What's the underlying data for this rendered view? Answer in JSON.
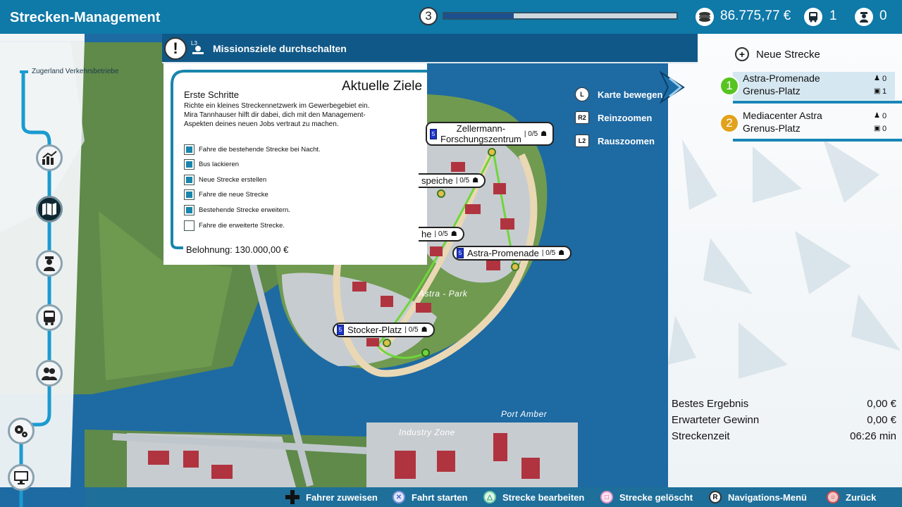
{
  "header": {
    "title": "Strecken-Management",
    "level": "3",
    "level_progress": 0.3,
    "money": "86.775,77 €",
    "buses": "1",
    "drivers": "0"
  },
  "sidebar": {
    "company": "Zugerland Verkehrsbetriebe",
    "items": [
      {
        "name": "statistics",
        "icon": "chart-icon"
      },
      {
        "name": "map",
        "icon": "map-icon",
        "active": true
      },
      {
        "name": "drivers",
        "icon": "driver-icon"
      },
      {
        "name": "buses",
        "icon": "bus-icon"
      },
      {
        "name": "people",
        "icon": "people-icon"
      },
      {
        "name": "settings",
        "icon": "gear-icon"
      },
      {
        "name": "computer",
        "icon": "monitor-icon"
      }
    ]
  },
  "mission": {
    "toggle_label": "Missionsziele durchschalten",
    "button_hint": "L3",
    "heading": "Aktuelle Ziele",
    "goal_title": "Erste Schritte",
    "goal_desc": "Richte ein kleines Streckennetzwerk im Gewerbegebiet ein. Mira Tannhauser hilft dir dabei, dich mit den Management-Aspekten deines neuen Jobs vertraut zu machen.",
    "tasks": [
      {
        "label": "Fahre die bestehende Strecke bei Nacht.",
        "done": true
      },
      {
        "label": "Bus lackieren",
        "done": true
      },
      {
        "label": "Neue Strecke erstellen",
        "done": true
      },
      {
        "label": "Fahre die neue Strecke",
        "done": true
      },
      {
        "label": "Bestehende Strecke erweitern.",
        "done": true
      },
      {
        "label": "Fahre die erweiterte Strecke.",
        "done": false
      }
    ],
    "reward": "Belohnung: 130.000,00 €"
  },
  "map": {
    "stops": [
      {
        "name": "Zellermann-\nForschungszentrum",
        "cap": "| 0/5"
      },
      {
        "name": "speiche",
        "cap": "| 0/5"
      },
      {
        "name": "he",
        "cap": "| 0/5"
      },
      {
        "name": "Astra-Promenade",
        "cap": "| 0/5"
      },
      {
        "name": "Stocker-Platz",
        "cap": "| 0/5"
      }
    ],
    "labels": {
      "park": "Astra - Park",
      "port": "Port Amber",
      "industry": "Industry Zone"
    },
    "controls": [
      {
        "key": "L",
        "label": "Karte bewegen"
      },
      {
        "key": "R2",
        "label": "Reinzoomen"
      },
      {
        "key": "L2",
        "label": "Rauszoomen"
      }
    ]
  },
  "routes": {
    "new_label": "Neue Strecke",
    "list": [
      {
        "num": "1",
        "line1": "Astra-Promenade",
        "line2": "Grenus-Platz",
        "drivers": "0",
        "buses": "1",
        "color": "#58c422"
      },
      {
        "num": "2",
        "line1": "Mediacenter Astra",
        "line2": "Grenus-Platz",
        "drivers": "0",
        "buses": "0",
        "color": "#e2a21c"
      }
    ]
  },
  "results": {
    "best_label": "Bestes Ergebnis",
    "best_value": "0,00 €",
    "expected_label": "Erwarteter Gewinn",
    "expected_value": "0,00 €",
    "time_label": "Streckenzeit",
    "time_value": "06:26 min"
  },
  "bottom": {
    "assign": "Fahrer zuweisen",
    "start": "Fahrt starten",
    "edit": "Strecke bearbeiten",
    "deleted": "Strecke gelöscht",
    "nav": "Navigations-Menü",
    "back": "Zurück"
  },
  "colors": {
    "accent": "#0f79a8",
    "water": "#1e6aa3",
    "land": "#5f8f4a",
    "route": "#6fd63a"
  }
}
